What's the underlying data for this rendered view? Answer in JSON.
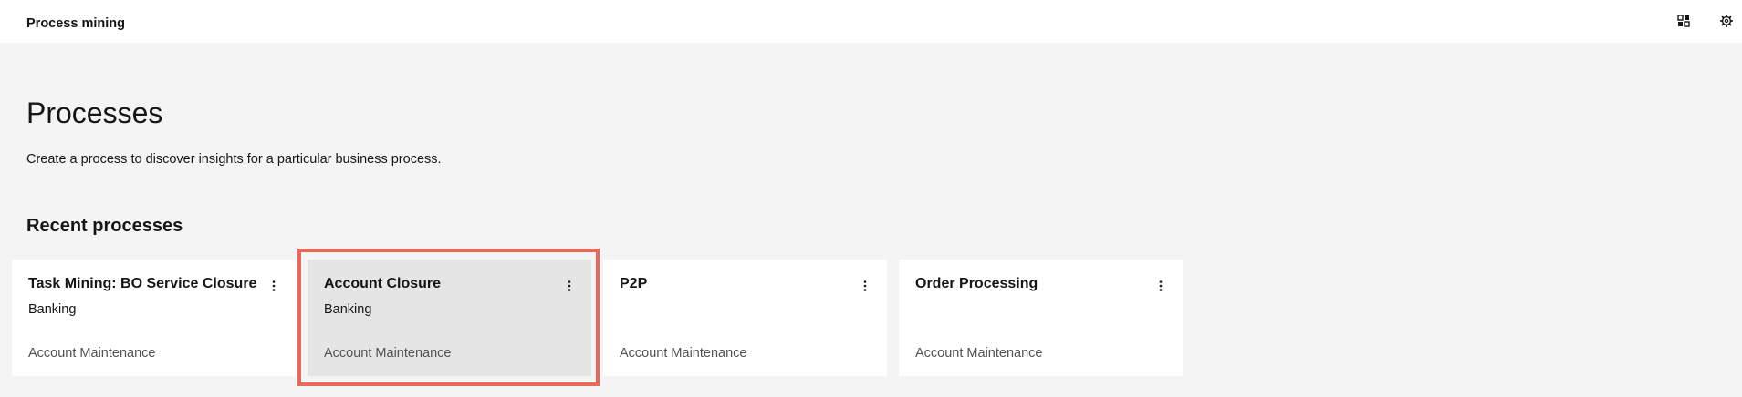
{
  "header": {
    "app_title": "Process mining",
    "icons": [
      "app-switcher-icon",
      "settings-gear-icon"
    ]
  },
  "main": {
    "title": "Processes",
    "description": "Create a process to discover insights for a particular business process.",
    "recent_title": "Recent processes"
  },
  "processes": [
    {
      "title": "Task Mining: BO Service Closure",
      "category": "Banking",
      "type": "Account Maintenance",
      "selected": false
    },
    {
      "title": "Account Closure",
      "category": "Banking",
      "type": "Account Maintenance",
      "selected": true
    },
    {
      "title": "P2P",
      "category": "",
      "type": "Account Maintenance",
      "selected": false
    },
    {
      "title": "Order Processing",
      "category": "",
      "type": "Account Maintenance",
      "selected": false
    }
  ],
  "colors": {
    "highlight": "#e8685a",
    "background": "#f4f4f4",
    "selected_card": "#e5e5e5"
  }
}
